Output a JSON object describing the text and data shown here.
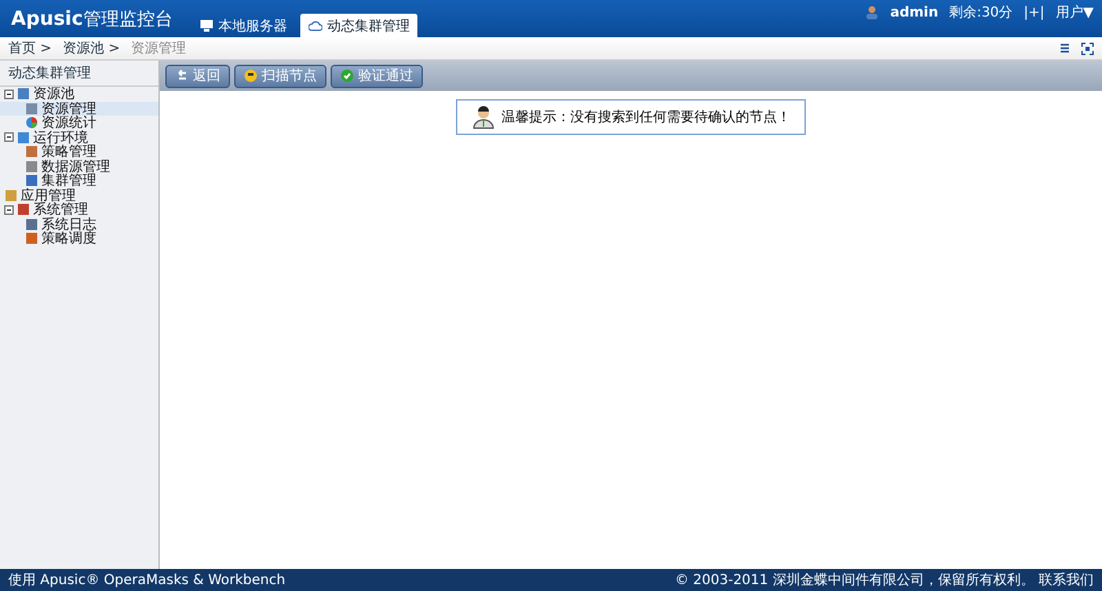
{
  "header": {
    "logo": "Apusic",
    "title": "管理监控台",
    "tabs": [
      {
        "label": "本地服务器",
        "selected": false
      },
      {
        "label": "动态集群管理",
        "selected": true
      }
    ],
    "user": "admin",
    "timeout": "剩余:30分",
    "lock": "|+|",
    "user_menu": "用户▼"
  },
  "breadcrumb": [
    "首页 >",
    "资源池 >",
    "资源管理"
  ],
  "sidebar": {
    "title": "动态集群管理",
    "tree": [
      {
        "label": "资源池",
        "expanded": true,
        "selected": false,
        "children": [
          {
            "label": "资源管理",
            "selected": true
          },
          {
            "label": "资源统计",
            "selected": false
          }
        ]
      },
      {
        "label": "运行环境",
        "expanded": true,
        "selected": false,
        "children": [
          {
            "label": "策略管理",
            "selected": false
          },
          {
            "label": "数据源管理",
            "selected": false
          },
          {
            "label": "集群管理",
            "selected": false
          }
        ]
      },
      {
        "label": "应用管理",
        "selected": false
      },
      {
        "label": "系统管理",
        "expanded": true,
        "selected": false,
        "children": [
          {
            "label": "系统日志",
            "selected": false
          },
          {
            "label": "策略调度",
            "selected": false
          }
        ]
      }
    ]
  },
  "toolbar": [
    {
      "label": "返回"
    },
    {
      "label": "扫描节点"
    },
    {
      "label": "验证通过"
    }
  ],
  "alert": {
    "label": "温馨提示：",
    "message": "没有搜索到任何需要待确认的节点！"
  },
  "footer": {
    "left": "使用 Apusic® OperaMasks & Workbench",
    "right": "© 2003-2011 深圳金蝶中间件有限公司，保留所有权利。 联系我们"
  }
}
